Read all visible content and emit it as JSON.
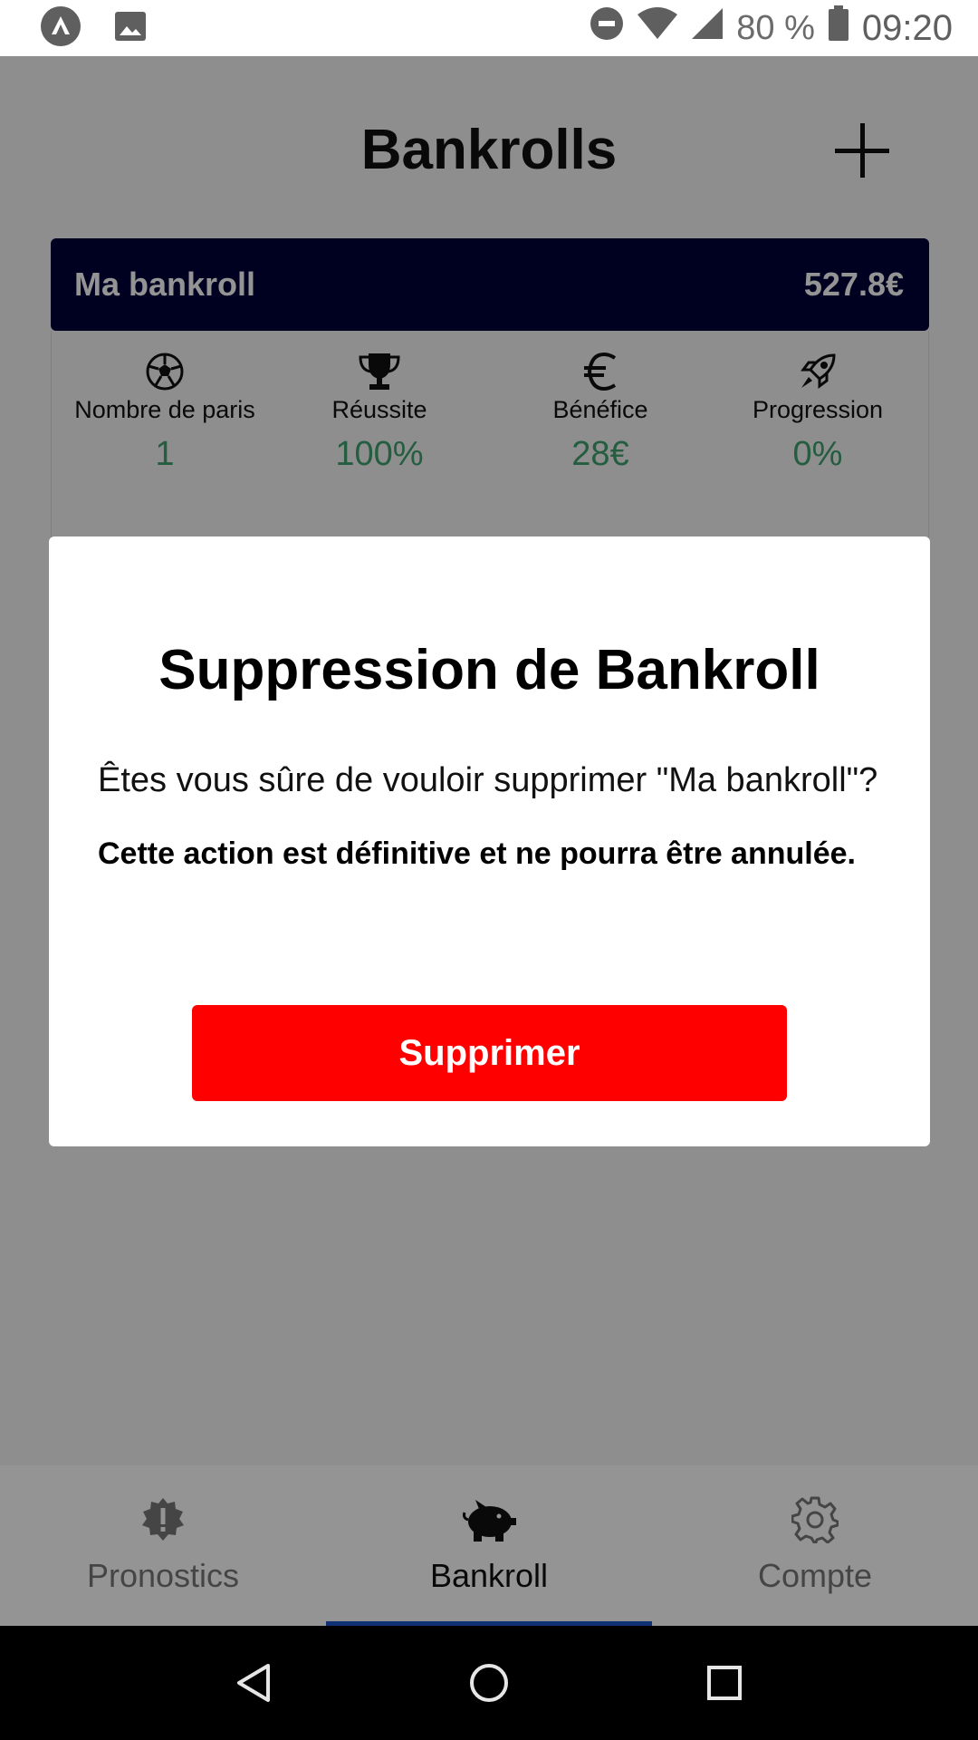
{
  "status_bar": {
    "battery_text": "80 %",
    "time": "09:20"
  },
  "header": {
    "title": "Bankrolls"
  },
  "bankroll": {
    "name": "Ma bankroll",
    "amount": "527.8€",
    "stats": [
      {
        "icon": "soccer-ball-icon",
        "label": "Nombre de paris",
        "value": "1"
      },
      {
        "icon": "trophy-icon",
        "label": "Réussite",
        "value": "100%"
      },
      {
        "icon": "euro-icon",
        "label": "Bénéfice",
        "value": "28€"
      },
      {
        "icon": "rocket-icon",
        "label": "Progression",
        "value": "0%"
      }
    ]
  },
  "dialog": {
    "title": "Suppression de Bankroll",
    "question": "Êtes vous sûre de vouloir supprimer \"Ma bankroll\"?",
    "warning": "Cette action est définitive et ne pourra être annulée.",
    "delete_label": "Supprimer"
  },
  "bottom_nav": {
    "items": [
      {
        "icon": "badge-alert-icon",
        "label": "Pronostics",
        "active": false
      },
      {
        "icon": "piggy-bank-icon",
        "label": "Bankroll",
        "active": true
      },
      {
        "icon": "gear-icon",
        "label": "Compte",
        "active": false
      }
    ]
  },
  "colors": {
    "card_header": "#01033a",
    "stat_value": "#3ea06d",
    "delete_button": "#ff0000",
    "active_tab_indicator": "#1d56c8"
  }
}
